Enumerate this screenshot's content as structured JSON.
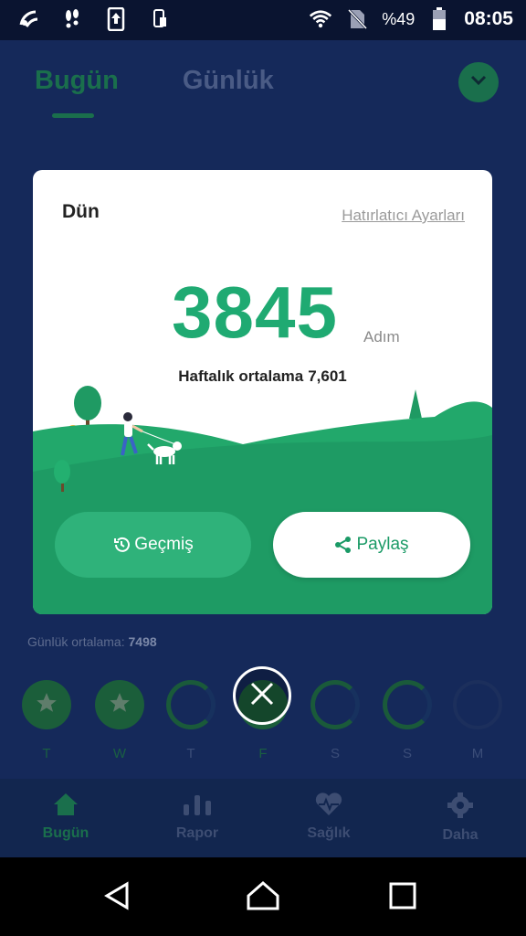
{
  "status_bar": {
    "battery_text": "%49",
    "time": "08:05"
  },
  "app": {
    "tabs": [
      {
        "label": "Bugün",
        "active": true
      },
      {
        "label": "Günlük",
        "active": false
      }
    ],
    "daily_average": {
      "label": "Günlük ortalama:",
      "value": "7498"
    },
    "week_days": [
      {
        "label": "T",
        "state": "complete"
      },
      {
        "label": "W",
        "state": "complete"
      },
      {
        "label": "T",
        "state": "partial"
      },
      {
        "label": "F",
        "state": "complete"
      },
      {
        "label": "S",
        "state": "partial"
      },
      {
        "label": "S",
        "state": "partial"
      },
      {
        "label": "M",
        "state": "empty"
      }
    ],
    "bottom_nav": [
      {
        "label": "Bugün",
        "icon": "home-icon",
        "active": true
      },
      {
        "label": "Rapor",
        "icon": "bar-chart-icon",
        "active": false
      },
      {
        "label": "Sağlık",
        "icon": "heart-pulse-icon",
        "active": false
      },
      {
        "label": "Daha",
        "icon": "gear-icon",
        "active": false
      }
    ]
  },
  "modal": {
    "title": "Dün",
    "reminder_link": "Hatırlatıcı Ayarları",
    "steps": "3845",
    "steps_unit": "Adım",
    "weekly_average_label": "Haftalık ortalama",
    "weekly_average_value": "7,601",
    "history_button": "Geçmiş",
    "share_button": "Paylaş"
  },
  "colors": {
    "accent": "#1faa72",
    "button_green": "#2fb27a",
    "background_dim": "#15295a"
  }
}
